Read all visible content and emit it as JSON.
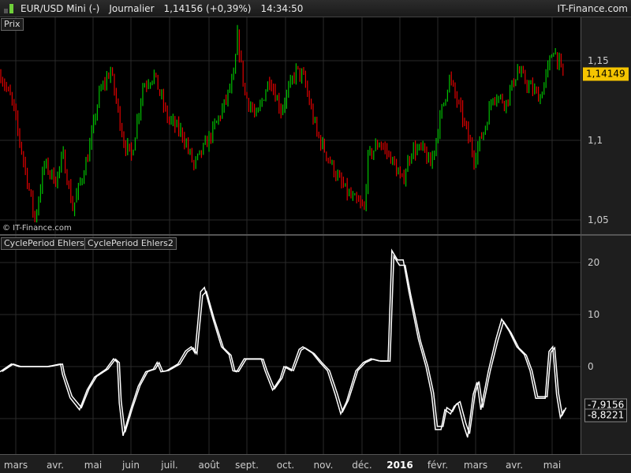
{
  "topbar": {
    "instrument": "EUR/USD Mini (-)",
    "period": "Journalier",
    "last": "1,14156 (+0,39%)",
    "time": "14:34:50",
    "brand": "IT-Finance.com",
    "icon": "candlestick-icon"
  },
  "price_panel": {
    "legend": "Prix",
    "copyright": "© IT-Finance.com",
    "y_ticks": [
      {
        "v": 1.15,
        "label": "1,15"
      },
      {
        "v": 1.1,
        "label": "1,1"
      },
      {
        "v": 1.05,
        "label": "1,05"
      }
    ],
    "current_price": {
      "v": 1.14149,
      "label": "1,14149"
    },
    "colors": {
      "up": "#00c000",
      "down": "#e00000"
    }
  },
  "indicator_panel": {
    "legends": [
      "CyclePeriod Ehlers",
      "CyclePeriod Ehlers2"
    ],
    "y_ticks": [
      {
        "v": 20,
        "label": "20"
      },
      {
        "v": 10,
        "label": "10"
      },
      {
        "v": 0,
        "label": "0"
      },
      {
        "v": -10,
        "label": ""
      }
    ],
    "values": [
      {
        "v": -7.9156,
        "label": "-7,9156"
      },
      {
        "v": -8.8221,
        "label": "-8,8221"
      }
    ]
  },
  "time_axis": [
    {
      "label": "mars"
    },
    {
      "label": "avr."
    },
    {
      "label": "mai"
    },
    {
      "label": "juin"
    },
    {
      "label": "juil."
    },
    {
      "label": "août"
    },
    {
      "label": "sept."
    },
    {
      "label": "oct."
    },
    {
      "label": "nov."
    },
    {
      "label": "déc."
    },
    {
      "label": "2016",
      "bold": true
    },
    {
      "label": "févr."
    },
    {
      "label": "mars"
    },
    {
      "label": "avr."
    },
    {
      "label": "mai"
    }
  ],
  "chart_data": [
    {
      "type": "candlestick",
      "title": "EUR/USD Mini (-) Journalier",
      "ylim": [
        1.04,
        1.175
      ],
      "n_bars": 298,
      "close_waypoints": [
        [
          0,
          1.141
        ],
        [
          6,
          1.124
        ],
        [
          15,
          1.069
        ],
        [
          18,
          1.05
        ],
        [
          23,
          1.085
        ],
        [
          29,
          1.075
        ],
        [
          33,
          1.09
        ],
        [
          38,
          1.057
        ],
        [
          46,
          1.09
        ],
        [
          52,
          1.129
        ],
        [
          58,
          1.144
        ],
        [
          65,
          1.099
        ],
        [
          69,
          1.09
        ],
        [
          75,
          1.134
        ],
        [
          81,
          1.141
        ],
        [
          88,
          1.114
        ],
        [
          96,
          1.104
        ],
        [
          102,
          1.084
        ],
        [
          110,
          1.101
        ],
        [
          117,
          1.119
        ],
        [
          123,
          1.139
        ],
        [
          125,
          1.165
        ],
        [
          129,
          1.129
        ],
        [
          135,
          1.114
        ],
        [
          142,
          1.139
        ],
        [
          148,
          1.119
        ],
        [
          156,
          1.144
        ],
        [
          160,
          1.139
        ],
        [
          167,
          1.104
        ],
        [
          173,
          1.089
        ],
        [
          179,
          1.074
        ],
        [
          185,
          1.064
        ],
        [
          192,
          1.057
        ],
        [
          194,
          1.089
        ],
        [
          200,
          1.099
        ],
        [
          206,
          1.089
        ],
        [
          212,
          1.074
        ],
        [
          217,
          1.094
        ],
        [
          223,
          1.094
        ],
        [
          227,
          1.084
        ],
        [
          233,
          1.119
        ],
        [
          237,
          1.139
        ],
        [
          244,
          1.114
        ],
        [
          250,
          1.089
        ],
        [
          256,
          1.109
        ],
        [
          260,
          1.129
        ],
        [
          267,
          1.124
        ],
        [
          273,
          1.144
        ],
        [
          279,
          1.134
        ],
        [
          285,
          1.127
        ],
        [
          292,
          1.158
        ],
        [
          297,
          1.141
        ]
      ]
    },
    {
      "type": "line",
      "title": "CyclePeriod Ehlers",
      "ylim": [
        -17,
        24
      ],
      "series": [
        {
          "name": "CyclePeriod Ehlers",
          "waypoints": [
            [
              0,
              -1
            ],
            [
              6,
              0.5
            ],
            [
              10,
              0
            ],
            [
              17,
              0
            ],
            [
              25,
              0
            ],
            [
              32,
              0.5
            ],
            [
              33,
              -1.5
            ],
            [
              37,
              -6
            ],
            [
              42,
              -8.3
            ],
            [
              46,
              -4.5
            ],
            [
              50,
              -2
            ],
            [
              56,
              -0.5
            ],
            [
              60,
              1.5
            ],
            [
              62,
              0.8
            ],
            [
              63,
              -7
            ],
            [
              65,
              -13.3
            ],
            [
              69,
              -8.3
            ],
            [
              73,
              -3.8
            ],
            [
              77,
              -1
            ],
            [
              81,
              -0.5
            ],
            [
              83,
              0.8
            ],
            [
              85,
              -1
            ],
            [
              88,
              -0.8
            ],
            [
              94,
              0.5
            ],
            [
              98,
              3
            ],
            [
              101,
              3.8
            ],
            [
              103,
              2.6
            ],
            [
              106,
              14.4
            ],
            [
              108,
              15.2
            ],
            [
              112,
              9.8
            ],
            [
              117,
              3.8
            ],
            [
              121,
              2.3
            ],
            [
              123,
              -0.8
            ],
            [
              125,
              -1
            ],
            [
              129,
              1.5
            ],
            [
              138,
              1.5
            ],
            [
              140,
              -0.8
            ],
            [
              144,
              -4.5
            ],
            [
              148,
              -2.3
            ],
            [
              150,
              0
            ],
            [
              154,
              -0.8
            ],
            [
              158,
              3.3
            ],
            [
              160,
              3.8
            ],
            [
              165,
              2.6
            ],
            [
              169,
              0.8
            ],
            [
              173,
              -0.8
            ],
            [
              177,
              -5.3
            ],
            [
              180,
              -9.1
            ],
            [
              183,
              -6.8
            ],
            [
              188,
              -0.8
            ],
            [
              192,
              0.8
            ],
            [
              196,
              1.5
            ],
            [
              200,
              1.1
            ],
            [
              205,
              1.1
            ],
            [
              207,
              22.3
            ],
            [
              210,
              20.5
            ],
            [
              213,
              20.5
            ],
            [
              216,
              14.4
            ],
            [
              221,
              5.3
            ],
            [
              225,
              0
            ],
            [
              228,
              -5.3
            ],
            [
              230,
              -12.1
            ],
            [
              233,
              -12.1
            ],
            [
              235,
              -8.3
            ],
            [
              238,
              -9.1
            ],
            [
              240,
              -7.6
            ],
            [
              242,
              -7.1
            ],
            [
              245,
              -11.4
            ],
            [
              247,
              -13.6
            ],
            [
              250,
              -5.3
            ],
            [
              252,
              -3
            ],
            [
              254,
              -8.3
            ],
            [
              258,
              -0.8
            ],
            [
              262,
              5.3
            ],
            [
              265,
              9.1
            ],
            [
              269,
              6.8
            ],
            [
              273,
              3.8
            ],
            [
              277,
              2.3
            ],
            [
              280,
              -0.8
            ],
            [
              283,
              -6.1
            ],
            [
              288,
              -6.1
            ],
            [
              290,
              2.9
            ],
            [
              292,
              3.8
            ],
            [
              294,
              -5.3
            ],
            [
              296,
              -9.8
            ],
            [
              298,
              -8.3
            ]
          ]
        },
        {
          "name": "CyclePeriod Ehlers2",
          "lag_bars": 1
        }
      ]
    }
  ]
}
